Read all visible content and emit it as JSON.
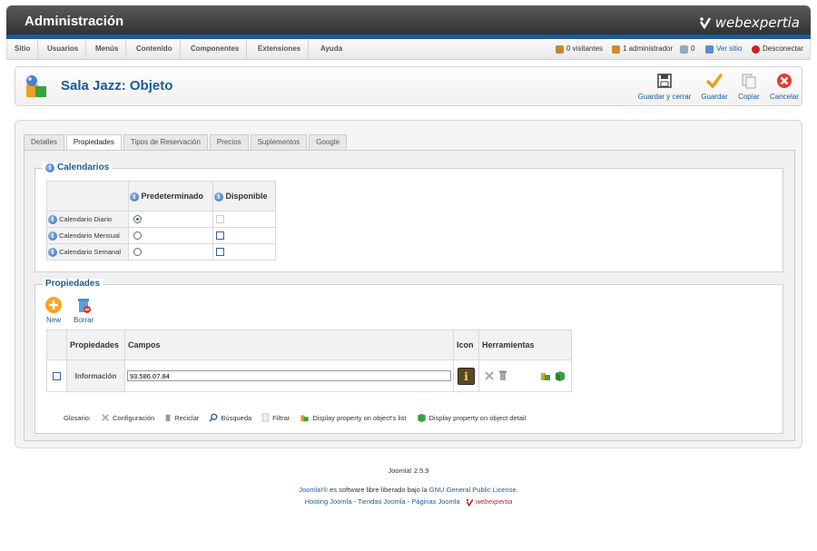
{
  "app": {
    "title": "Administración",
    "brand": "webexpertia"
  },
  "menu": [
    "Sitio",
    "Usuarios",
    "Menús",
    "Contenido",
    "Componentes",
    "Extensiones",
    "Ayuda"
  ],
  "status": {
    "visitors": "0 visitantes",
    "admins": "1 administrador",
    "messages": "0",
    "view_site": "Ver sitio",
    "logout": "Desconectar"
  },
  "page": {
    "title": "Sala Jazz: Objeto"
  },
  "toolbar": {
    "save_close": "Guardar y cerrar",
    "save": "Guardar",
    "copy": "Copiar",
    "cancel": "Cancelar"
  },
  "tabs": [
    "Detalles",
    "Propiedades",
    "Tipos de Reservación",
    "Precios",
    "Suplementos",
    "Google"
  ],
  "active_tab": "Propiedades",
  "calendars": {
    "legend": "Calendarios",
    "col_default": "Predeterminado",
    "col_available": "Disponible",
    "rows": [
      {
        "name": "Calendario Diario",
        "default": true,
        "available_disabled": true
      },
      {
        "name": "Calendario Mensual",
        "default": false,
        "available_disabled": false
      },
      {
        "name": "Calendario Semanal",
        "default": false,
        "available_disabled": false
      }
    ]
  },
  "properties": {
    "legend": "Propiedades",
    "new_label": "New",
    "delete_label": "Borrar",
    "headers": {
      "props": "Propiedades",
      "fields": "Campos",
      "icon": "Icon",
      "tools": "Herramientas"
    },
    "row": {
      "name": "Información",
      "value": "93.586.07.84"
    }
  },
  "glossary": {
    "label": "Glosario:",
    "items": [
      "Configuración",
      "Reciclar",
      "Búsqueda",
      "Filtrar",
      "Display property on object's list",
      "Display property on object detail"
    ]
  },
  "footer": {
    "version": "Joomla! 2.5.9",
    "line1_link": "Joomla!®",
    "line1_text": " es software libre liberado bajo la ",
    "line1_license": "GNU General Public License",
    "line1_end": ".",
    "hosting": "Hosting Joomla",
    "sep1": " - ",
    "stores": "Tiendas Joomla",
    "sep2": " - ",
    "pages": "Páginas Joomla",
    "brand": "webexpertia"
  },
  "colors": {
    "accent": "#1a5b9a",
    "topbar": "#3a3a3a",
    "cancel": "#e23b2e",
    "save": "#f39a1c"
  }
}
